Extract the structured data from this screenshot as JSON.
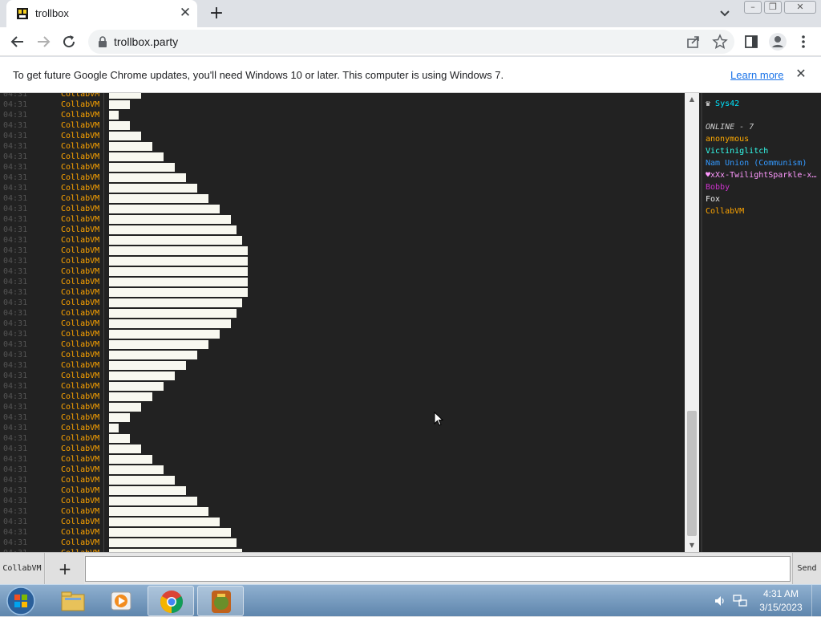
{
  "browser": {
    "tab_title": "trollbox",
    "url": "trollbox.party",
    "new_tab_symbol": "+",
    "close_symbol": "✕",
    "window_controls": [
      "minimize",
      "restore",
      "close"
    ],
    "infobar": {
      "message": "To get future Google Chrome updates, you'll need Windows 10 or later. This computer is using Windows 7.",
      "link": "Learn more"
    }
  },
  "chat": {
    "nick_color": "#ffa500",
    "time_color": "#555555",
    "bar_color": "#f8f8f0",
    "messages": [
      {
        "time": "04:31",
        "nick": "CollabVM",
        "level": 2
      },
      {
        "time": "04:31",
        "nick": "CollabVM",
        "level": 1
      },
      {
        "time": "04:31",
        "nick": "CollabVM",
        "level": 0
      },
      {
        "time": "04:31",
        "nick": "CollabVM",
        "level": 1
      },
      {
        "time": "04:31",
        "nick": "CollabVM",
        "level": 2
      },
      {
        "time": "04:31",
        "nick": "CollabVM",
        "level": 3
      },
      {
        "time": "04:31",
        "nick": "CollabVM",
        "level": 4
      },
      {
        "time": "04:31",
        "nick": "CollabVM",
        "level": 5
      },
      {
        "time": "04:31",
        "nick": "CollabVM",
        "level": 6
      },
      {
        "time": "04:31",
        "nick": "CollabVM",
        "level": 7
      },
      {
        "time": "04:31",
        "nick": "CollabVM",
        "level": 8
      },
      {
        "time": "04:31",
        "nick": "CollabVM",
        "level": 9
      },
      {
        "time": "04:31",
        "nick": "CollabVM",
        "level": 10
      },
      {
        "time": "04:31",
        "nick": "CollabVM",
        "level": 10.5
      },
      {
        "time": "04:31",
        "nick": "CollabVM",
        "level": 11
      },
      {
        "time": "04:31",
        "nick": "CollabVM",
        "level": 11.5
      },
      {
        "time": "04:31",
        "nick": "CollabVM",
        "level": 11.5
      },
      {
        "time": "04:31",
        "nick": "CollabVM",
        "level": 11.5
      },
      {
        "time": "04:31",
        "nick": "CollabVM",
        "level": 11.5
      },
      {
        "time": "04:31",
        "nick": "CollabVM",
        "level": 11.5
      },
      {
        "time": "04:31",
        "nick": "CollabVM",
        "level": 11
      },
      {
        "time": "04:31",
        "nick": "CollabVM",
        "level": 10.5
      },
      {
        "time": "04:31",
        "nick": "CollabVM",
        "level": 10
      },
      {
        "time": "04:31",
        "nick": "CollabVM",
        "level": 9
      },
      {
        "time": "04:31",
        "nick": "CollabVM",
        "level": 8
      },
      {
        "time": "04:31",
        "nick": "CollabVM",
        "level": 7
      },
      {
        "time": "04:31",
        "nick": "CollabVM",
        "level": 6
      },
      {
        "time": "04:31",
        "nick": "CollabVM",
        "level": 5
      },
      {
        "time": "04:31",
        "nick": "CollabVM",
        "level": 4
      },
      {
        "time": "04:31",
        "nick": "CollabVM",
        "level": 3
      },
      {
        "time": "04:31",
        "nick": "CollabVM",
        "level": 2
      },
      {
        "time": "04:31",
        "nick": "CollabVM",
        "level": 1
      },
      {
        "time": "04:31",
        "nick": "CollabVM",
        "level": 0
      },
      {
        "time": "04:31",
        "nick": "CollabVM",
        "level": 1
      },
      {
        "time": "04:31",
        "nick": "CollabVM",
        "level": 2
      },
      {
        "time": "04:31",
        "nick": "CollabVM",
        "level": 3
      },
      {
        "time": "04:31",
        "nick": "CollabVM",
        "level": 4
      },
      {
        "time": "04:31",
        "nick": "CollabVM",
        "level": 5
      },
      {
        "time": "04:31",
        "nick": "CollabVM",
        "level": 6
      },
      {
        "time": "04:31",
        "nick": "CollabVM",
        "level": 7
      },
      {
        "time": "04:31",
        "nick": "CollabVM",
        "level": 8
      },
      {
        "time": "04:31",
        "nick": "CollabVM",
        "level": 9
      },
      {
        "time": "04:31",
        "nick": "CollabVM",
        "level": 10
      },
      {
        "time": "04:31",
        "nick": "CollabVM",
        "level": 10.5
      },
      {
        "time": "04:31",
        "nick": "CollabVM",
        "level": 11
      }
    ]
  },
  "users": {
    "owner": {
      "name": "Sys42",
      "color": "#00e5ff",
      "icon": "crown-icon"
    },
    "online_label": "ONLINE - 7",
    "list": [
      {
        "name": "anonymous",
        "color": "#ffaa00"
      },
      {
        "name": "Victiniglitch",
        "color": "#33ffee"
      },
      {
        "name": "Nam Union (Communism)",
        "color": "#3399ff"
      },
      {
        "name": "♥xXx-TwilightSparkle-xXx",
        "color": "#ff99ff"
      },
      {
        "name": "Bobby",
        "color": "#cc33cc"
      },
      {
        "name": "Fox",
        "color": "#eeeeee"
      },
      {
        "name": "CollabVM",
        "color": "#ffa500"
      }
    ]
  },
  "input": {
    "room_label": "CollabVM",
    "add_label": "+",
    "send_label": "Send",
    "placeholder": ""
  },
  "taskbar": {
    "time": "4:31 AM",
    "date": "3/15/2023",
    "items": [
      "explorer-icon",
      "media-player-icon",
      "chrome-icon",
      "trollbox-app-icon"
    ]
  }
}
